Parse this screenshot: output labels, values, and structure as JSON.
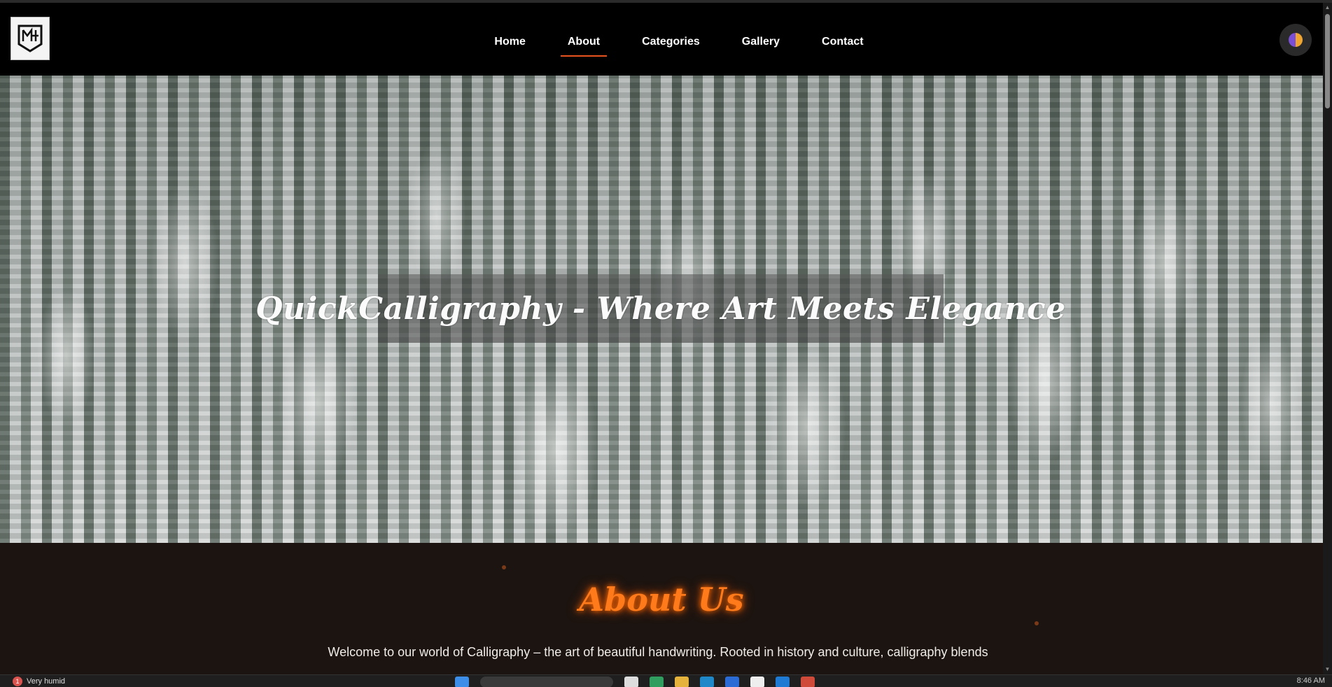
{
  "navbar": {
    "logo_alt": "Site logo",
    "links": [
      {
        "label": "Home",
        "active": false
      },
      {
        "label": "About",
        "active": true
      },
      {
        "label": "Categories",
        "active": false
      },
      {
        "label": "Gallery",
        "active": false
      },
      {
        "label": "Contact",
        "active": false
      }
    ],
    "accent_color": "#e8531f",
    "theme_toggle_icon": "half-moon-icon"
  },
  "hero": {
    "title": "QuickCalligraphy - Where Art Meets Elegance"
  },
  "about": {
    "heading": "About Us",
    "heading_color": "#ff7a1a",
    "text": "Welcome to our world of Calligraphy – the art of beautiful handwriting. Rooted in history and culture, calligraphy blends"
  },
  "taskbar": {
    "weather_badge": "1",
    "weather_text": "Very humid",
    "time": "8:46 AM"
  }
}
